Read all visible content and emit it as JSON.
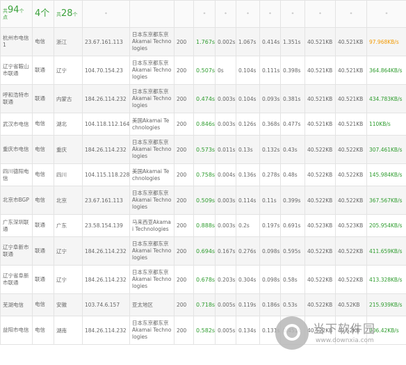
{
  "header": {
    "node_prefix": "共",
    "node_count": "94",
    "node_suffix": "个",
    "node_unit": "点",
    "isp_count": "4个",
    "region_prefix": "共",
    "region_count": "28",
    "region_suffix": "个",
    "star": "*"
  },
  "rows": [
    {
      "node": "杭州市电信1",
      "isp": "电信",
      "region": "浙江",
      "ip": "23.67.161.113",
      "location": "日本东京都东京Akamai Technologies",
      "status": "200",
      "total": "1.767s",
      "dns": "0.002s",
      "connect": "1.067s",
      "download": "0.414s",
      "head": "1.351s",
      "size1": "40.521KB",
      "size2": "40.521KB",
      "speed": "97.968KB/s",
      "speed_warn": true
    },
    {
      "node": "辽宁省鞍山市联通",
      "isp": "联通",
      "region": "辽宁",
      "ip": "104.70.154.23",
      "location": "日本东京都东京Akamai Technologies",
      "status": "200",
      "total": "0.507s",
      "dns": "0s",
      "connect": "0.104s",
      "download": "0.111s",
      "head": "0.398s",
      "size1": "40.521KB",
      "size2": "40.521KB",
      "speed": "364.864KB/s",
      "speed_warn": false
    },
    {
      "node": "呼和浩特市联通",
      "isp": "联通",
      "region": "内蒙古",
      "ip": "184.26.114.232",
      "location": "日本东京都东京Akamai Technologies",
      "status": "200",
      "total": "0.474s",
      "dns": "0.003s",
      "connect": "0.104s",
      "download": "0.093s",
      "head": "0.381s",
      "size1": "40.521KB",
      "size2": "40.521KB",
      "speed": "434.783KB/s",
      "speed_warn": false
    },
    {
      "node": "武汉市电信",
      "isp": "电信",
      "region": "湖北",
      "ip": "104.118.112.164",
      "location": "美国Akamai Technologies",
      "status": "200",
      "total": "0.846s",
      "dns": "0.003s",
      "connect": "0.126s",
      "download": "0.368s",
      "head": "0.477s",
      "size1": "40.521KB",
      "size2": "40.521KB",
      "speed": "110KB/s",
      "speed_warn": false
    },
    {
      "node": "重庆市电信",
      "isp": "电信",
      "region": "重庆",
      "ip": "184.26.114.232",
      "location": "日本东京都东京Akamai Technologies",
      "status": "200",
      "total": "0.573s",
      "dns": "0.011s",
      "connect": "0.13s",
      "download": "0.132s",
      "head": "0.43s",
      "size1": "40.522KB",
      "size2": "40.522KB",
      "speed": "307.461KB/s",
      "speed_warn": false
    },
    {
      "node": "四川德阳电信",
      "isp": "电信",
      "region": "四川",
      "ip": "104.115.118.228",
      "location": "美国Akamai Technologies",
      "status": "200",
      "total": "0.758s",
      "dns": "0.004s",
      "connect": "0.136s",
      "download": "0.278s",
      "head": "0.48s",
      "size1": "40.522KB",
      "size2": "40.522KB",
      "speed": "145.984KB/s",
      "speed_warn": false
    },
    {
      "node": "北京市BGP",
      "isp": "电信",
      "region": "北京",
      "ip": "23.67.161.113",
      "location": "日本东京都东京Akamai Technologies",
      "status": "200",
      "total": "0.509s",
      "dns": "0.003s",
      "connect": "0.114s",
      "download": "0.11s",
      "head": "0.399s",
      "size1": "40.522KB",
      "size2": "40.522KB",
      "speed": "367.567KB/s",
      "speed_warn": false
    },
    {
      "node": "广东深圳联通",
      "isp": "联通",
      "region": "广东",
      "ip": "23.58.154.139",
      "location": "马来西亚Akamai Technologies",
      "status": "200",
      "total": "0.888s",
      "dns": "0.003s",
      "connect": "0.2s",
      "download": "0.197s",
      "head": "0.691s",
      "size1": "40.523KB",
      "size2": "40.523KB",
      "speed": "205.954KB/s",
      "speed_warn": false
    },
    {
      "node": "辽宁阜新市联通",
      "isp": "联通",
      "region": "辽宁",
      "ip": "184.26.114.232",
      "location": "日本东京都东京Akamai Technologies",
      "status": "200",
      "total": "0.694s",
      "dns": "0.167s",
      "connect": "0.276s",
      "download": "0.098s",
      "head": "0.595s",
      "size1": "40.522KB",
      "size2": "40.522KB",
      "speed": "411.659KB/s",
      "speed_warn": false
    },
    {
      "node": "辽宁省阜新市联通",
      "isp": "联通",
      "region": "辽宁",
      "ip": "184.26.114.232",
      "location": "日本东京都东京Akamai Technologies",
      "status": "200",
      "total": "0.678s",
      "dns": "0.203s",
      "connect": "0.304s",
      "download": "0.098s",
      "head": "0.58s",
      "size1": "40.522KB",
      "size2": "40.522KB",
      "speed": "413.328KB/s",
      "speed_warn": false
    },
    {
      "node": "芜湖电信",
      "isp": "电信",
      "region": "安徽",
      "ip": "103.74.6.157",
      "location": "亚太地区",
      "status": "200",
      "total": "0.718s",
      "dns": "0.005s",
      "connect": "0.119s",
      "download": "0.186s",
      "head": "0.53s",
      "size1": "40.522KB",
      "size2": "40.52KB",
      "speed": "215.939KB/s",
      "speed_warn": false
    },
    {
      "node": "益阳市电信",
      "isp": "电信",
      "region": "湖南",
      "ip": "184.26.114.232",
      "location": "日本东京都东京Akamai Technologies",
      "status": "200",
      "total": "0.582s",
      "dns": "0.005s",
      "connect": "0.134s",
      "download": "0.131s",
      "head": "0.451s",
      "size1": "40.522KB",
      "size2": "40.52KB",
      "speed": "306.42KB/s",
      "speed_warn": false
    }
  ],
  "watermark": {
    "name": "当下软件园",
    "url": "www.downxia.com"
  }
}
